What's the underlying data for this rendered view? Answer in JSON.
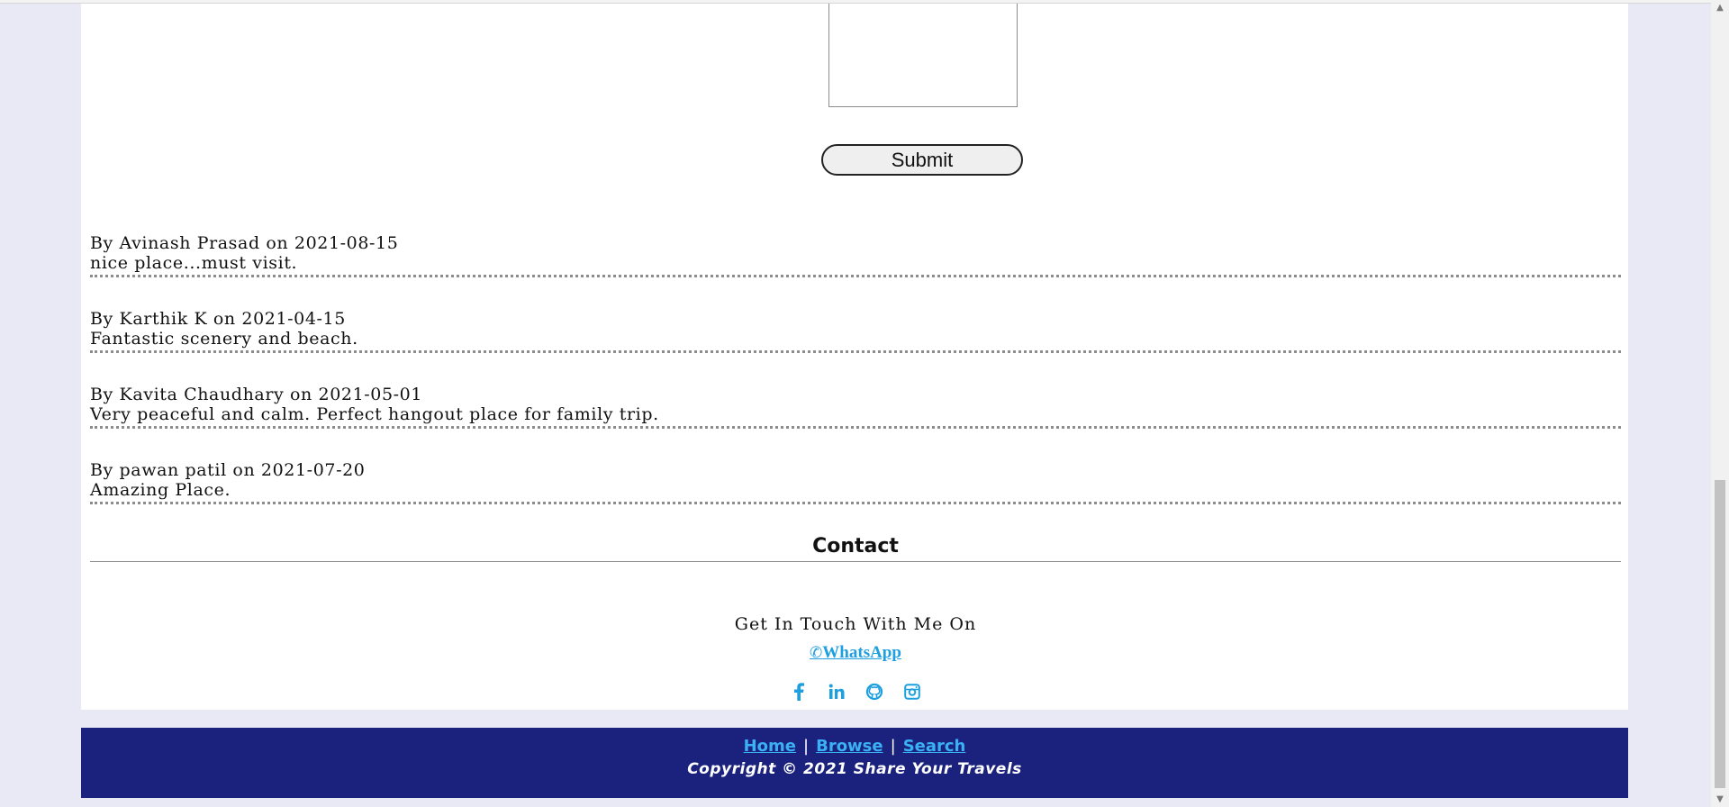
{
  "form": {
    "submit_label": "Submit"
  },
  "reviews": [
    {
      "meta": "By Avinash Prasad on 2021-08-15",
      "text": "nice place...must visit."
    },
    {
      "meta": "By Karthik K on 2021-04-15",
      "text": "Fantastic scenery and beach."
    },
    {
      "meta": "By Kavita Chaudhary on 2021-05-01",
      "text": "Very peaceful and calm. Perfect hangout place for family trip."
    },
    {
      "meta": "By pawan patil on 2021-07-20",
      "text": "Amazing Place."
    }
  ],
  "contact": {
    "title": "Contact",
    "touch_text": "Get In Touch With Me On",
    "whatsapp_label": "WhatsApp",
    "social_icons": [
      "facebook-icon",
      "linkedin-icon",
      "github-icon",
      "instagram-icon"
    ]
  },
  "footer": {
    "links": [
      "Home",
      "Browse",
      "Search"
    ],
    "copyright": "Copyright © 2021 Share Your Travels"
  },
  "colors": {
    "page_bg": "#e8e9f5",
    "footer_bg": "#1a227e",
    "link": "#3ab0f5",
    "whatsapp": "#1e9fe0"
  }
}
